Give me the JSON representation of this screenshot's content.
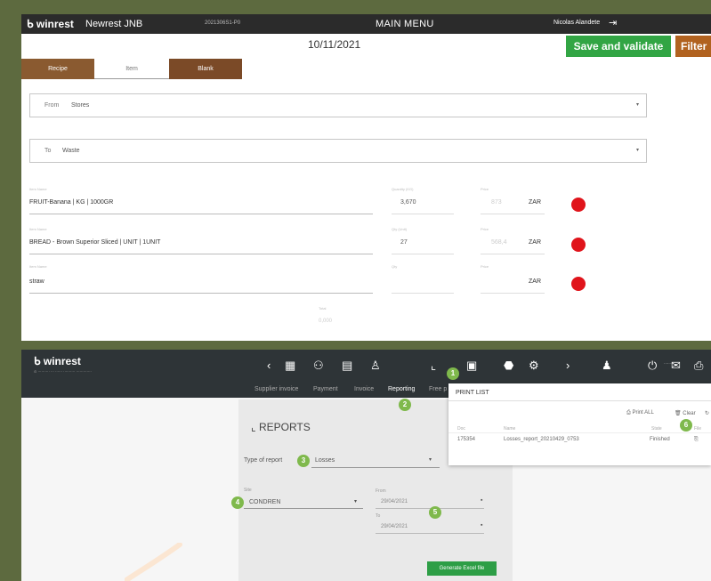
{
  "top": {
    "logo": "winrest",
    "venue": "Newrest JNB",
    "code": "2021306S1-P0",
    "menu": "MAIN MENU",
    "user": "Nicolas Alandete",
    "date": "10/11/2021",
    "save_label": "Save and validate",
    "filter_label": "Filter",
    "tabs": [
      "Recipe",
      "Item",
      "Blank"
    ],
    "from": {
      "label": "From",
      "value": "Stores"
    },
    "to": {
      "label": "To",
      "value": "Waste"
    },
    "rows": [
      {
        "name": "FRUIT-Banana | KG | 1000GR",
        "qty": "3,670",
        "price": "873",
        "currency": "ZAR"
      },
      {
        "name": "BREAD - Brown Superior Sliced | UNIT | 1UNIT",
        "qty": "27",
        "price": "568,4",
        "currency": "ZAR"
      },
      {
        "name": "straw",
        "qty": "",
        "price": "",
        "currency": "ZAR"
      }
    ],
    "total_value": "0,000"
  },
  "bottom": {
    "logo": "winrest",
    "nav_links": [
      "Supplier invoice",
      "Payment",
      "Invoice",
      "Reporting",
      "Free p"
    ],
    "reports_title": "REPORTS",
    "type_label": "Type of report",
    "type_value": "Losses",
    "site_label": "Site",
    "site_value": "CONDREN",
    "from_label": "From",
    "from_value": "29/04/2021",
    "to_label": "To",
    "to_value": "29/04/2021",
    "generate_label": "Generate Excel file",
    "print": {
      "title": "PRINT LIST",
      "print_all": "Print ALL",
      "clear": "Clear",
      "headers": [
        "Doc",
        "Name",
        "State",
        "File"
      ],
      "row": {
        "doc": "175354",
        "name": "Losses_report_20210429_0753",
        "state": "Finished"
      }
    },
    "badges": [
      "1",
      "2",
      "3",
      "4",
      "5",
      "6"
    ]
  },
  "colors": {
    "save": "#32a544",
    "filter": "#b1621f",
    "badge": "#7fb94c",
    "delete": "#e0141b",
    "background": "#5d6a3f"
  }
}
